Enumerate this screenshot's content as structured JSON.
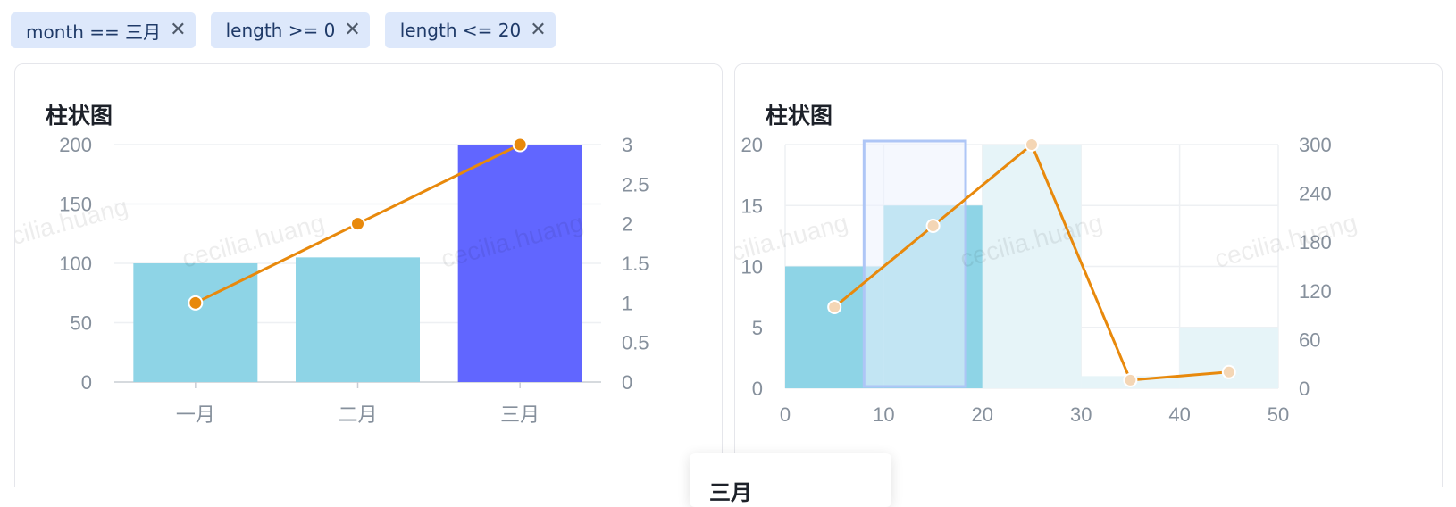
{
  "filters": [
    {
      "label": "month == 三月"
    },
    {
      "label": "length >= 0"
    },
    {
      "label": "length <= 20"
    }
  ],
  "close_glyph": "✕",
  "watermark": "cecilia.huang",
  "colors": {
    "bar": "#8ed4e6",
    "bar_active": "#6166ff",
    "line": "#e8890c",
    "hist_dim": "#e6f4f8",
    "selection": "#aec6f6",
    "selection_fill": "#edf3fd"
  },
  "tooltip": {
    "title": "三月"
  },
  "chart_data": [
    {
      "type": "bar",
      "title": "柱状图",
      "categories": [
        "一月",
        "二月",
        "三月"
      ],
      "series": [
        {
          "values": [
            100,
            105,
            200
          ]
        },
        {
          "type": "line",
          "axis": "right",
          "values": [
            1,
            2,
            3
          ]
        }
      ],
      "highlighted_category": "三月",
      "ylim": [
        0,
        200
      ],
      "y_ticks": [
        0,
        50,
        100,
        150,
        200
      ],
      "y2lim": [
        0,
        3
      ],
      "y2_ticks": [
        "0",
        "0.5",
        "1",
        "1.5",
        "2",
        "2.5",
        "3"
      ],
      "grid": true
    },
    {
      "type": "bar",
      "title": "柱状图",
      "bins": [
        [
          0,
          10
        ],
        [
          10,
          20
        ],
        [
          20,
          30
        ],
        [
          30,
          40
        ],
        [
          40,
          50
        ]
      ],
      "series": [
        {
          "values": [
            10,
            15,
            20,
            1,
            5
          ]
        },
        {
          "type": "line",
          "axis": "right",
          "x": [
            5,
            15,
            25,
            35,
            45
          ],
          "values": [
            100,
            200,
            300,
            10,
            20
          ]
        }
      ],
      "active_bins": [
        [
          0,
          10
        ],
        [
          10,
          20
        ]
      ],
      "brush_selection": [
        8,
        18.3
      ],
      "xlim": [
        0,
        50
      ],
      "x_ticks": [
        0,
        10,
        20,
        30,
        40,
        50
      ],
      "ylim": [
        0,
        20
      ],
      "y_ticks": [
        0,
        5,
        10,
        15,
        20
      ],
      "y2lim": [
        0,
        300
      ],
      "y2_ticks": [
        0,
        60,
        120,
        180,
        240,
        300
      ],
      "grid": true
    }
  ]
}
